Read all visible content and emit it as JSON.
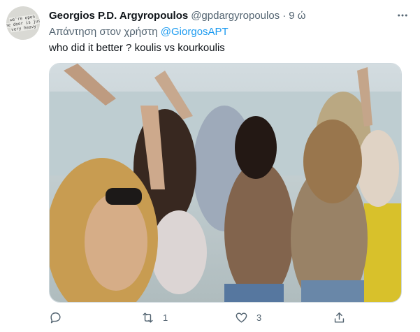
{
  "tweet": {
    "avatar": {
      "lines": [
        "we're open",
        "the door is just",
        "very heavy"
      ]
    },
    "display_name": "Georgios P.D. Argyropoulos",
    "handle": "@gpdargyropoulos",
    "separator": "·",
    "time": "9 ώ",
    "reply_prefix": "Απάντηση στον χρήστη",
    "reply_to": "@GiorgosAPT",
    "text": "who did it better ? koulis vs kourkoulis",
    "media": {
      "kind": "video-still",
      "alt": ""
    },
    "actions": {
      "reply_icon": "reply-icon",
      "retweet_icon": "retweet-icon",
      "retweet_count": "1",
      "like_icon": "heart-icon",
      "like_count": "3",
      "share_icon": "share-icon"
    },
    "more_icon": "more-horizontal-icon"
  },
  "colors": {
    "text": "#0f1419",
    "secondary": "#536471",
    "link": "#1d9bf0",
    "border": "#cfd9de"
  }
}
